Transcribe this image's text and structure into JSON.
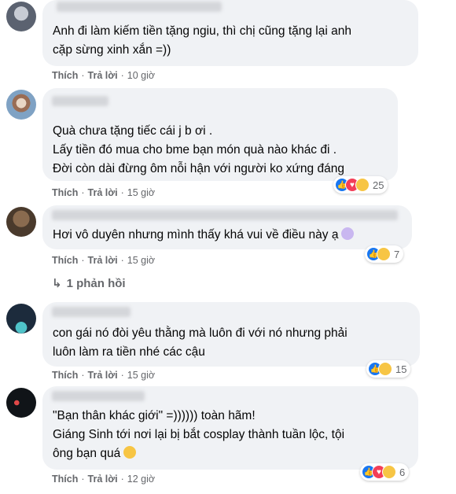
{
  "comments": [
    {
      "text": "Anh đi làm kiếm tiền tặng ngiu, thì chị cũng tặng lại anh\ncặp sừng xinh xắn =))",
      "like_label": "Thích",
      "reply_label": "Trả lời",
      "time": "10 giờ"
    },
    {
      "text": "Quà chưa tặng tiếc cái j b ơi .\nLấy tiền đó mua cho bme bạn món quà nào khác đi .\nĐời còn dài đừng ôm nỗi hận với người ko xứng đáng",
      "like_label": "Thích",
      "reply_label": "Trả lời",
      "time": "15 giờ",
      "reaction_icons": [
        "like",
        "love",
        "haha"
      ],
      "reaction_count": "25"
    },
    {
      "text": "Hơi vô duyên nhưng mình thấy khá vui về điều này ạ",
      "like_label": "Thích",
      "reply_label": "Trả lời",
      "time": "15 giờ",
      "reaction_icons": [
        "like",
        "haha"
      ],
      "reaction_count": "7",
      "replies_label": "1 phản hồi"
    },
    {
      "text": "con gái nó đòi yêu thằng mà luôn đi với nó nhưng phải\nluôn làm ra tiền nhé các cậu",
      "like_label": "Thích",
      "reply_label": "Trả lời",
      "time": "15 giờ",
      "reaction_icons": [
        "like",
        "haha"
      ],
      "reaction_count": "15"
    },
    {
      "text": "\"Bạn thân khác giới\" =)))))) toàn hãm!\nGiáng Sinh tới nơi lại bị bắt cosplay thành tuần lộc, tội\nông bạn quá",
      "like_label": "Thích",
      "reply_label": "Trả lời",
      "time": "12 giờ",
      "reaction_icons": [
        "like",
        "love",
        "haha"
      ],
      "reaction_count": "6"
    }
  ],
  "colors": {
    "bubble": "#f0f2f5",
    "meta": "#65676b",
    "like": "#1877f2",
    "love": "#f33e58",
    "haha": "#f7c544"
  }
}
